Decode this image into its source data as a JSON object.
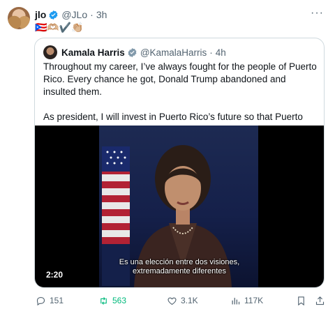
{
  "post": {
    "author_name": "jlo",
    "author_handle": "@JLo",
    "separator": "·",
    "time": "3h",
    "emojis": "🇵🇷🫶🏼✔️👏🏼",
    "more_label": "···"
  },
  "quote": {
    "author_name": "Kamala Harris",
    "author_handle": "@KamalaHarris",
    "separator": "·",
    "time": "4h",
    "paragraph_1": "Throughout my career, I’ve always fought for the people of Puerto Rico. Every chance he got, Donald Trump abandoned and insulted them.",
    "paragraph_2": "As president, I will invest in Puerto Rico’s future so that Puerto Ricans can not just get by, but get ahead.",
    "video": {
      "duration": "2:20",
      "subtitle_line_1": "Es una elección entre dos visiones,",
      "subtitle_line_2": "extremadamente diferentes"
    }
  },
  "actions": {
    "replies": "151",
    "reposts": "563",
    "likes": "3.1K",
    "views": "117K"
  },
  "colors": {
    "verified": "#1d9bf0",
    "repost": "#00ba7c",
    "muted": "#536471"
  }
}
